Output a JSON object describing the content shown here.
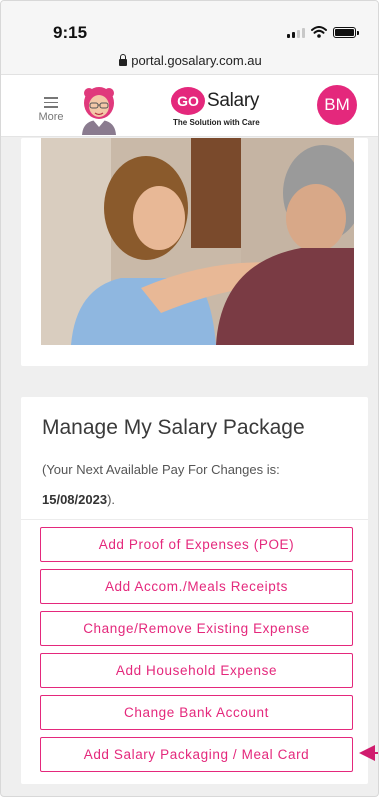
{
  "status_bar": {
    "time": "9:15"
  },
  "browser": {
    "url": "portal.gosalary.com.au"
  },
  "header": {
    "menu_label": "More",
    "logo_go": "GO",
    "logo_word": "Salary",
    "logo_tagline": "The Solution with Care",
    "user_initials": "BM"
  },
  "colors": {
    "brand_pink": "#e4287c",
    "background": "#efefef"
  },
  "manage": {
    "title": "Manage My Salary Package",
    "note_prefix": "(Your Next Available Pay For Changes is:",
    "note_date": "15/08/2023",
    "note_suffix": ").",
    "actions": [
      {
        "label": "Add Proof of Expenses (POE)"
      },
      {
        "label": "Add Accom./Meals Receipts"
      },
      {
        "label": "Change/Remove Existing Expense"
      },
      {
        "label": "Add Household Expense"
      },
      {
        "label": "Change Bank Account"
      },
      {
        "label": "Add Salary Packaging / Meal Card"
      }
    ]
  }
}
